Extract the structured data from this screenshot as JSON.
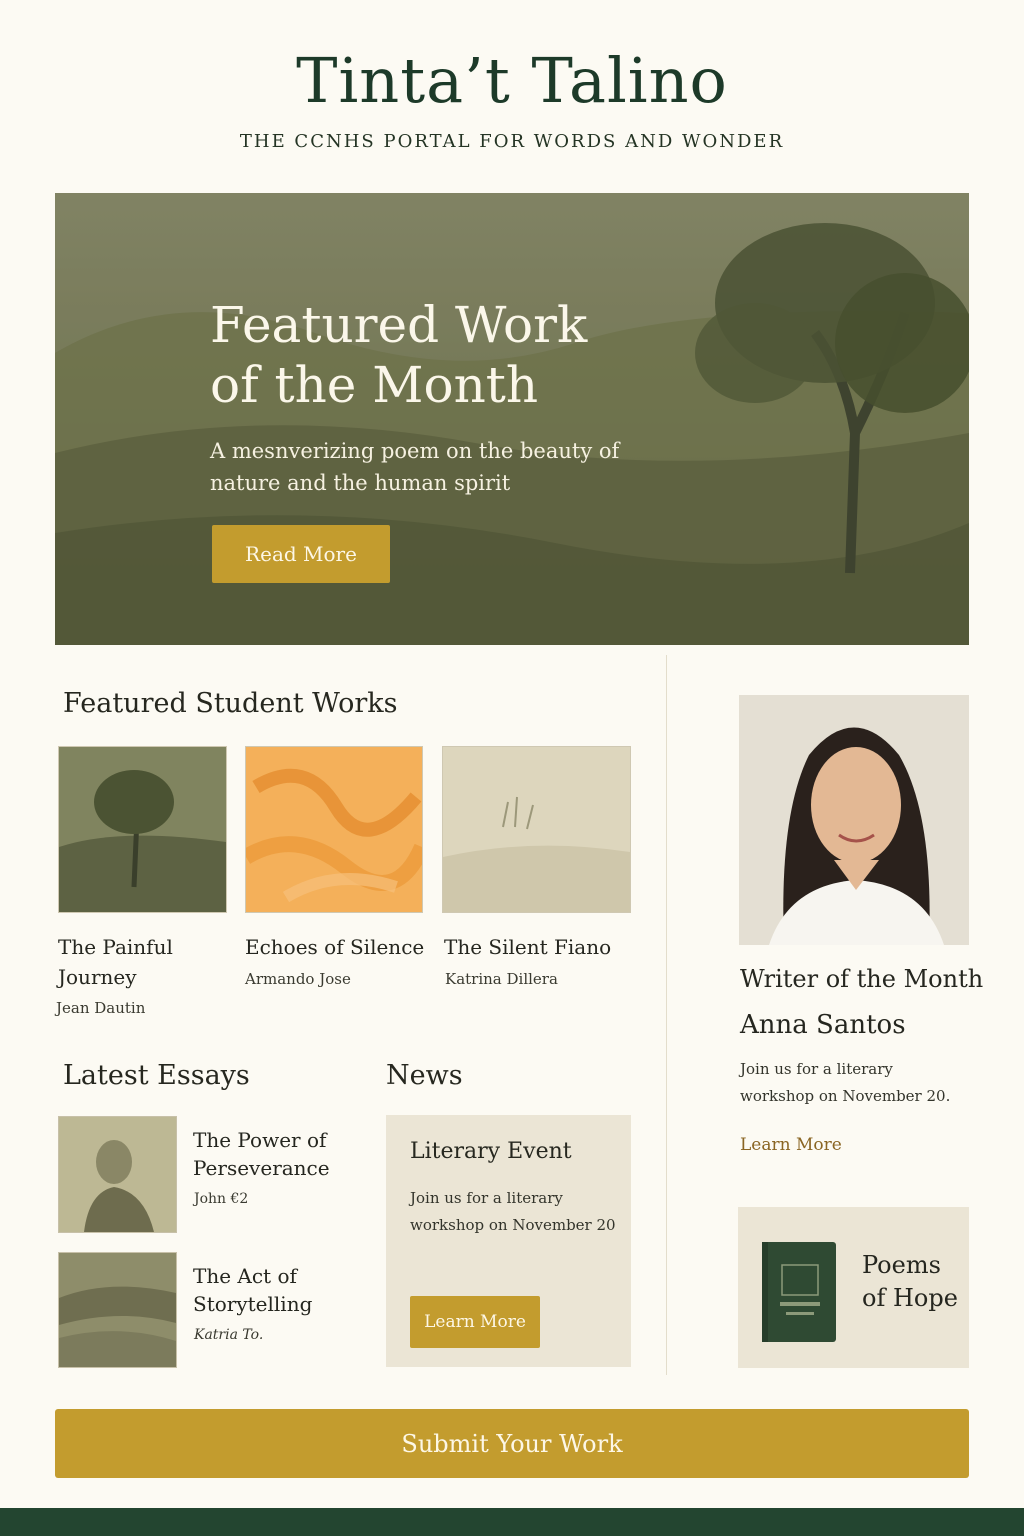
{
  "header": {
    "title": "Tinta’t Talino",
    "tagline": "THE CCNHS PORTAL FOR WORDS AND WONDER"
  },
  "hero": {
    "title": "Featured Work of the Month",
    "description": "A mesnverizing poem on the beauty of nature and the human spirit",
    "button_label": "Read More"
  },
  "student_works": {
    "heading": "Featured Student Works",
    "items": [
      {
        "title": "The Painful Journey",
        "author": "Jean Dautin"
      },
      {
        "title": "Echoes of Silence",
        "author": "Armando Jose"
      },
      {
        "title": "The Silent Fiano",
        "author": "Katrina Dillera"
      }
    ]
  },
  "essays": {
    "heading": "Latest Essays",
    "items": [
      {
        "title": "The Power of Perseverance",
        "author": "John €2"
      },
      {
        "title": "The Act of Storytelling",
        "author": "Katria To."
      }
    ]
  },
  "news": {
    "heading": "News",
    "event_title": "Literary Event",
    "event_text": "Join us for a literary workshop on November 20",
    "button_label": "Learn More"
  },
  "writer": {
    "heading": "Writer of the Month",
    "name": "Anna Santos",
    "text": "Join us for a literary workshop on November 20.",
    "link_label": "Learn More"
  },
  "book": {
    "title": "Poems of Hope"
  },
  "submit": {
    "label": "Submit Your Work"
  },
  "colors": {
    "background": "#fcfaf3",
    "accent_gold": "#c39c2e",
    "brand_green": "#1d3a29",
    "card_beige": "#ebe5d5"
  }
}
